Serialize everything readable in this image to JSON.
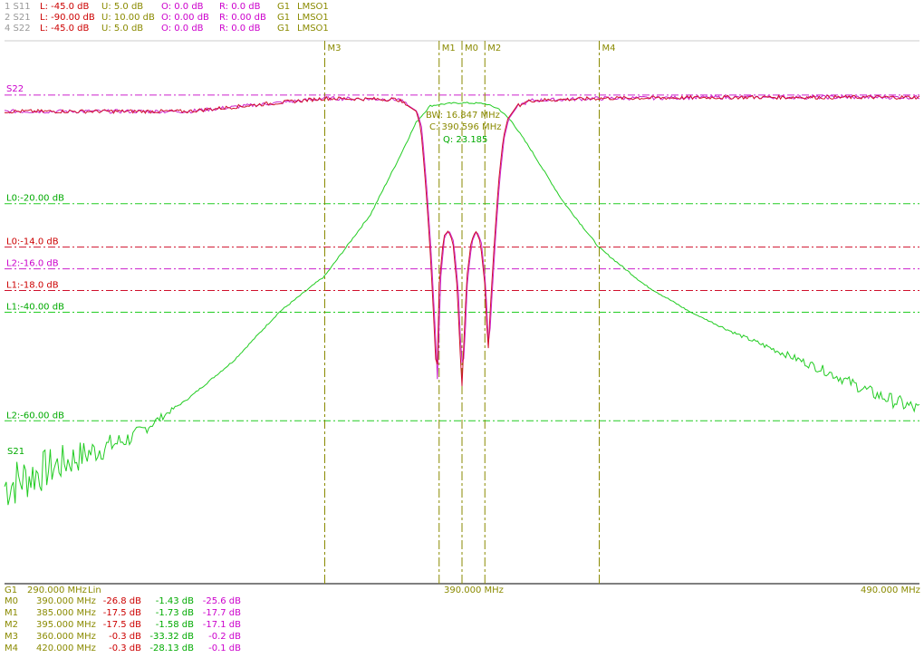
{
  "header": {
    "traces": [
      {
        "id": "1 S11",
        "L": "L: -45.0 dB",
        "U": "U:  5.0 dB",
        "O": "O:  0.0 dB",
        "R": "R:  0.0 dB",
        "G": "G1",
        "src": "LMSO1"
      },
      {
        "id": "2 S21",
        "L": "L: -90.00 dB",
        "U": "U: 10.00 dB",
        "O": "O:  0.00 dB",
        "R": "R:  0.00 dB",
        "G": "G1",
        "src": "LMSO1"
      },
      {
        "id": "4 S22",
        "L": "L: -45.0 dB",
        "U": "U:  5.0 dB",
        "O": "O:  0.0 dB",
        "R": "R:  0.0 dB",
        "G": "G1",
        "src": "LMSO1"
      }
    ]
  },
  "colors": {
    "s11": "#d0102c",
    "s21": "#22cc22",
    "s22": "#cc22cc",
    "marker": "#8a8a00",
    "text_red": "#cc0000",
    "text_green": "#00aa00",
    "text_magenta": "#cc00cc",
    "gray": "#999999",
    "axis": "#000000"
  },
  "chart_data": {
    "type": "line",
    "x_range_mhz": [
      290,
      490
    ],
    "x_start_label": "290.000 MHz",
    "x_center_label": "390.000 MHz",
    "x_end_label": "490.000 MHz",
    "sweep_label": "G1",
    "scale_label": "Lin",
    "trace_labels": {
      "s22": "S22",
      "s21": "S21"
    },
    "reflection_db": [
      [
        290,
        -1.5
      ],
      [
        330,
        -1.5
      ],
      [
        360,
        -0.3
      ],
      [
        376,
        -0.4
      ],
      [
        380,
        -1.5
      ],
      [
        381,
        -3
      ],
      [
        382,
        -8
      ],
      [
        383,
        -14
      ],
      [
        384,
        -22
      ],
      [
        384.5,
        -27
      ],
      [
        385,
        -17.5
      ],
      [
        386,
        -13
      ],
      [
        387,
        -12.5
      ],
      [
        388,
        -13.5
      ],
      [
        389,
        -18
      ],
      [
        389.5,
        -23
      ],
      [
        390,
        -26.8
      ],
      [
        390.5,
        -22
      ],
      [
        391,
        -17
      ],
      [
        392,
        -13.5
      ],
      [
        393,
        -12.5
      ],
      [
        394,
        -13.5
      ],
      [
        395,
        -17.5
      ],
      [
        395.7,
        -24
      ],
      [
        396,
        -21
      ],
      [
        397,
        -14
      ],
      [
        398,
        -8
      ],
      [
        399,
        -4
      ],
      [
        400,
        -2.2
      ],
      [
        402,
        -1
      ],
      [
        405,
        -0.5
      ],
      [
        420,
        -0.3
      ],
      [
        450,
        -0.2
      ],
      [
        490,
        -0.2
      ]
    ],
    "s21_db": [
      [
        290,
        -72
      ],
      [
        305,
        -67
      ],
      [
        318,
        -63
      ],
      [
        330,
        -56
      ],
      [
        340,
        -49
      ],
      [
        350,
        -40
      ],
      [
        360,
        -33.32
      ],
      [
        370,
        -22
      ],
      [
        376,
        -12
      ],
      [
        380,
        -5
      ],
      [
        383,
        -2
      ],
      [
        385,
        -1.73
      ],
      [
        388,
        -1.5
      ],
      [
        390,
        -1.43
      ],
      [
        393,
        -1.5
      ],
      [
        395,
        -1.58
      ],
      [
        398,
        -2.5
      ],
      [
        401,
        -5
      ],
      [
        405,
        -10
      ],
      [
        412,
        -19.5
      ],
      [
        420,
        -28.13
      ],
      [
        430,
        -35
      ],
      [
        440,
        -40
      ],
      [
        450,
        -44
      ],
      [
        460,
        -47.5
      ],
      [
        470,
        -51
      ],
      [
        480,
        -55
      ],
      [
        490,
        -58
      ]
    ],
    "s21_noise_amplitude_db": 5,
    "limit_lines": [
      {
        "label": "L0:-20.00 dB",
        "trace": "s21",
        "db": -20,
        "range": [
          -90,
          10
        ]
      },
      {
        "label": "L0:-14.0 dB",
        "trace": "s11",
        "db": -14,
        "range": [
          -45,
          5
        ]
      },
      {
        "label": "L2:-16.0 dB",
        "trace": "s22",
        "db": -16,
        "range": [
          -45,
          5
        ]
      },
      {
        "label": "L1:-18.0 dB",
        "trace": "s11",
        "db": -18,
        "range": [
          -45,
          5
        ]
      },
      {
        "label": "L1:-40.00 dB",
        "trace": "s21",
        "db": -40,
        "range": [
          -90,
          10
        ]
      },
      {
        "label": "L2:-60.00 dB",
        "trace": "s21",
        "db": -60,
        "range": [
          -90,
          10
        ]
      }
    ],
    "reference_line_db": {
      "value": 0,
      "range": [
        -45,
        5
      ]
    },
    "markers": [
      {
        "name": "M0",
        "freq": 390
      },
      {
        "name": "M1",
        "freq": 385
      },
      {
        "name": "M2",
        "freq": 395
      },
      {
        "name": "M3",
        "freq": 360
      },
      {
        "name": "M4",
        "freq": 420
      }
    ],
    "bw_info": [
      "BW: 16.847 MHz",
      "C: 390.596 MHz",
      "Q: 23.185"
    ]
  },
  "marker_table": [
    {
      "name": "M0",
      "freq": "390.000 MHz",
      "s11": "-26.8 dB",
      "s21": "-1.43 dB",
      "s22": "-25.6 dB"
    },
    {
      "name": "M1",
      "freq": "385.000 MHz",
      "s11": "-17.5 dB",
      "s21": "-1.73 dB",
      "s22": "-17.7 dB"
    },
    {
      "name": "M2",
      "freq": "395.000 MHz",
      "s11": "-17.5 dB",
      "s21": "-1.58 dB",
      "s22": "-17.1 dB"
    },
    {
      "name": "M3",
      "freq": "360.000 MHz",
      "s11": "-0.3 dB",
      "s21": "-33.32 dB",
      "s22": "-0.2 dB"
    },
    {
      "name": "M4",
      "freq": "420.000 MHz",
      "s11": "-0.3 dB",
      "s21": "-28.13 dB",
      "s22": "-0.1 dB"
    }
  ]
}
